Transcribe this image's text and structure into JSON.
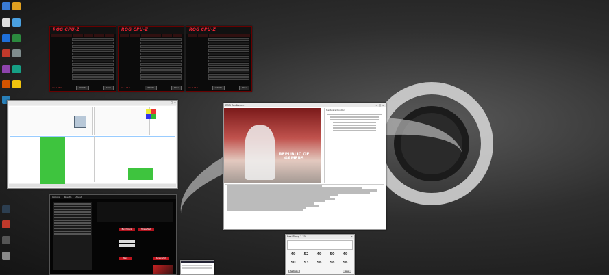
{
  "cpuz_windows": [
    {
      "title": "ROG CPU-Z",
      "version": "Ver. 1.86.0",
      "ok_label": "Validate",
      "close_label": "Close"
    },
    {
      "title": "ROG CPU-Z",
      "version": "Ver. 1.86.0",
      "ok_label": "Validate",
      "close_label": "Close"
    },
    {
      "title": "ROG CPU-Z",
      "version": "Ver. 1.86.0",
      "ok_label": "Validate",
      "close_label": "Close"
    }
  ],
  "video_window": {
    "title": "ROG Realbench",
    "overlay_text_line1": "REPUBLIC OF",
    "overlay_text_line2": "GAMERS",
    "tree_title": "Hardware Monitor"
  },
  "tool_window": {
    "menu": [
      "Options",
      "Results",
      "About"
    ],
    "benchmark_label": "Benchmark",
    "stress_label": "Stress Test",
    "start_label": "Start",
    "stop_label": "Screenshot"
  },
  "temp_window": {
    "title": "Real Temp 3.70",
    "row1": [
      "49",
      "52",
      "49",
      "50",
      "49"
    ],
    "row2": [
      "50",
      "53",
      "56",
      "58",
      "56"
    ],
    "footer": [
      "Settings",
      "Reset"
    ]
  },
  "colors": {
    "rog_red": "#e22233",
    "sensor_green": "#3ec43e"
  }
}
